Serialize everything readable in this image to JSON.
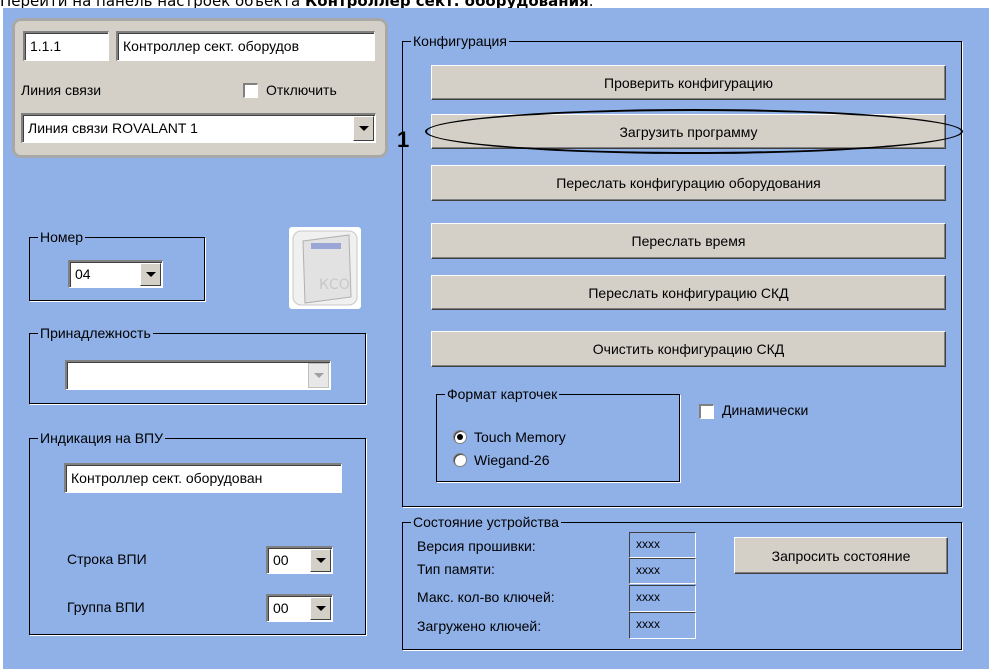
{
  "caption": {
    "prefix": "Перейти на панель настроек объекта ",
    "bold": "Контроллер сект. оборудования",
    "suffix": "."
  },
  "header": {
    "id_value": "1.1.1",
    "name_value": "Контроллер сект. оборудов",
    "line_label": "Линия связи",
    "disable_label": "Отключить",
    "line_select_value": "Линия связи ROVALANT 1"
  },
  "number_group": {
    "title": "Номер",
    "value": "04"
  },
  "belong_group": {
    "title": "Принадлежность",
    "value": ""
  },
  "indication_group": {
    "title": "Индикация на ВПУ",
    "text_value": "Контроллер сект. оборудован",
    "row_label": "Строка ВПИ",
    "row_value": "00",
    "group_label": "Группа ВПИ",
    "group_value": "00"
  },
  "config_group": {
    "title": "Конфигурация",
    "buttons": [
      "Проверить конфигурацию",
      "Загрузить программу",
      "Переслать конфигурацию оборудования",
      "Переслать время",
      "Переслать конфигурацию СКД",
      "Очистить конфигурацию СКД"
    ],
    "callout_number": "1",
    "card_format": {
      "title": "Формат карточек",
      "options": [
        "Touch Memory",
        "Wiegand-26"
      ],
      "selected": "Touch Memory"
    },
    "dynamic_label": "Динамически"
  },
  "status_group": {
    "title": "Состояние устройства",
    "rows": [
      {
        "label": "Версия прошивки:",
        "value": "xxxx"
      },
      {
        "label": "Тип памяти:",
        "value": "xxxx"
      },
      {
        "label": "Макс. кол-во ключей:",
        "value": "xxxx"
      },
      {
        "label": "Загружено ключей:",
        "value": "xxxx"
      }
    ],
    "request_button": "Запросить состояние"
  },
  "colors": {
    "panel": "#8fb1e8",
    "button": "#d4d0c8",
    "header_box": "#d4d0c8"
  },
  "icons": {
    "device_image": "controller-device-icon"
  }
}
